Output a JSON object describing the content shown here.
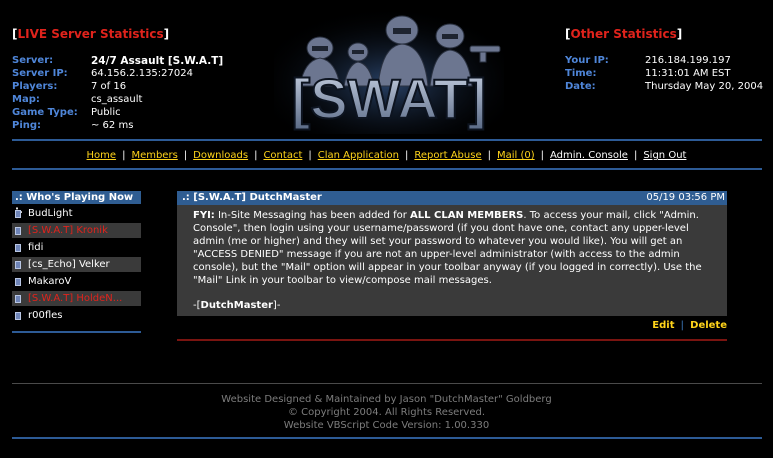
{
  "live_stats": {
    "bracket_open": "[",
    "title": "LIVE Server Statistics",
    "bracket_close": "]",
    "rows": [
      {
        "label": "Server:",
        "value": "24/7 Assault [S.W.A.T]"
      },
      {
        "label": "Server IP:",
        "value": "64.156.2.135:27024"
      },
      {
        "label": "Players:",
        "value": "7 of 16"
      },
      {
        "label": "Map:",
        "value": "cs_assault"
      },
      {
        "label": "Game Type:",
        "value": "Public"
      },
      {
        "label": "Ping:",
        "value": "~ 62 ms"
      }
    ]
  },
  "other_stats": {
    "bracket_open": "[",
    "title": "Other Statistics",
    "bracket_close": "]",
    "rows": [
      {
        "label": "Your IP:",
        "value": "216.184.199.197"
      },
      {
        "label": "Time:",
        "value": "11:31:01 AM EST"
      },
      {
        "label": "Date:",
        "value": "Thursday May 20, 2004"
      }
    ]
  },
  "logo": {
    "text": "[SWAT]"
  },
  "nav": {
    "items": [
      "Home",
      "Members",
      "Downloads",
      "Contact",
      "Clan Application",
      "Report Abuse",
      "Mail (0)",
      "Admin. Console",
      "Sign Out"
    ],
    "separator": "|"
  },
  "whos_playing": {
    "title": ".: Who's Playing Now :.",
    "players": [
      "BudLight",
      "[S.W.A.T] Kronik",
      "fidi",
      "[cs_Echo] Velker",
      "MakaroV",
      "[S.W.A.T] HoldeN...",
      "r00fles"
    ]
  },
  "message": {
    "title": ".: [S.W.A.T] DutchMaster",
    "date": "05/19 03:56 PM",
    "fyi": "FYI:",
    "p1": " In-Site Messaging has been added for ",
    "emph": "ALL CLAN MEMBERS",
    "p2": ". To access your mail, click \"Admin. Console\", then login using your username/password (if you dont have one, contact any upper-level admin (me or higher) and they will set your password to whatever you would like). You will get an \"ACCESS DENIED\" message if you are not an upper-level administrator (with access to the admin console), but the \"Mail\" option will appear in your toolbar anyway (if you logged in correctly). Use the \"Mail\" Link in your toolbar to view/compose mail messages.",
    "sig_pre": "-[",
    "sig_name": "DutchMaster",
    "sig_post": "]-",
    "edit": "Edit",
    "sep": "|",
    "delete": "Delete"
  },
  "footer": {
    "line1": "Website Designed & Maintained by Jason \"DutchMaster\" Goldberg",
    "line2": "© Copyright 2004. All Rights Reserved.",
    "line3": "Website VBScript Code Version: 1.00.330"
  }
}
